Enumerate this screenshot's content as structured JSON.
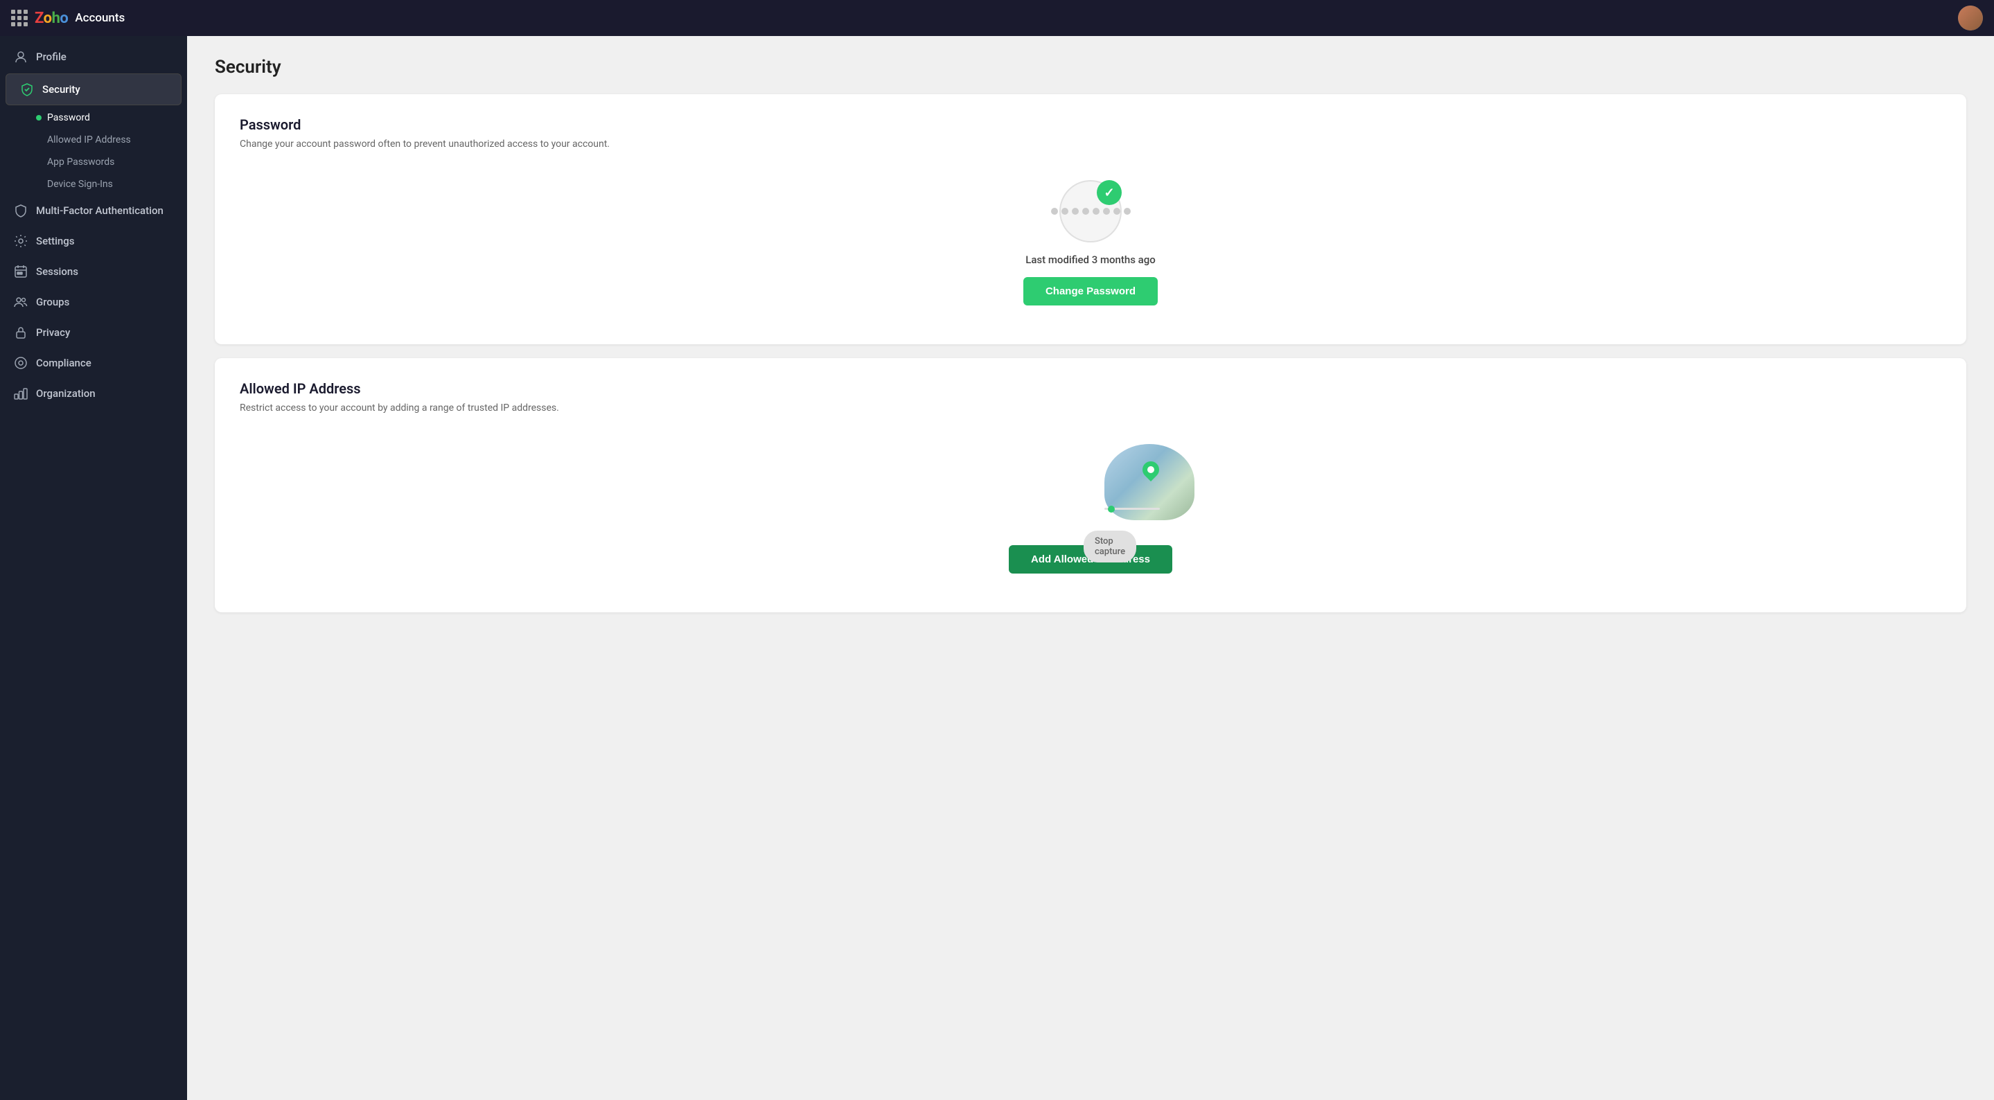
{
  "topbar": {
    "app_name": "Accounts",
    "logo_letters": [
      "Z",
      "o",
      "h",
      "o"
    ]
  },
  "sidebar": {
    "items": [
      {
        "id": "profile",
        "label": "Profile",
        "icon": "user-icon"
      },
      {
        "id": "security",
        "label": "Security",
        "icon": "shield-icon",
        "active": true
      },
      {
        "id": "mfa",
        "label": "Multi-Factor Authentication",
        "icon": "shield-lock-icon"
      },
      {
        "id": "settings",
        "label": "Settings",
        "icon": "settings-icon"
      },
      {
        "id": "sessions",
        "label": "Sessions",
        "icon": "calendar-icon"
      },
      {
        "id": "groups",
        "label": "Groups",
        "icon": "groups-icon"
      },
      {
        "id": "privacy",
        "label": "Privacy",
        "icon": "lock-icon"
      },
      {
        "id": "compliance",
        "label": "Compliance",
        "icon": "compliance-icon"
      },
      {
        "id": "organization",
        "label": "Organization",
        "icon": "org-icon"
      }
    ],
    "security_sub": [
      {
        "id": "password",
        "label": "Password",
        "active": true
      },
      {
        "id": "allowed-ip",
        "label": "Allowed IP Address"
      },
      {
        "id": "app-passwords",
        "label": "App Passwords"
      },
      {
        "id": "device-signins",
        "label": "Device Sign-Ins"
      }
    ]
  },
  "page": {
    "title": "Security"
  },
  "password_card": {
    "title": "Password",
    "description": "Change your account password often to prevent unauthorized access to your account.",
    "last_modified": "Last modified 3 months ago",
    "change_button": "Change Password"
  },
  "ip_card": {
    "title": "Allowed IP Address",
    "description": "Restrict access to your account by adding a range of trusted IP addresses.",
    "stop_capture": "Stop capture",
    "add_button": "Add Allowed IP Address"
  }
}
